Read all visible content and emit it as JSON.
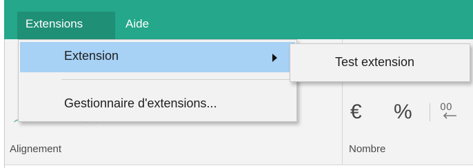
{
  "menubar": {
    "items": [
      {
        "label": "Extensions",
        "active": true
      },
      {
        "label": "Aide",
        "active": false
      }
    ],
    "color": "#24a78a",
    "active_color": "#1f8f76"
  },
  "dropdown": {
    "items": [
      {
        "label": "Extension",
        "has_submenu": true,
        "highlighted": true
      },
      {
        "label": "Gestionnaire d'extensions...",
        "has_submenu": false,
        "highlighted": false
      }
    ],
    "highlight_color": "#a7d1f5"
  },
  "submenu": {
    "items": [
      {
        "label": "Test extension"
      }
    ]
  },
  "ribbon": {
    "groups": [
      {
        "label": "Alignement"
      },
      {
        "label": "Nombre"
      }
    ],
    "number_format_icons": [
      {
        "glyph": "€",
        "icon": "currency-euro-icon"
      },
      {
        "glyph": "%",
        "icon": "percent-icon"
      },
      {
        "glyph": "⁰⁰",
        "icon": "decrease-decimal-icon"
      }
    ]
  }
}
